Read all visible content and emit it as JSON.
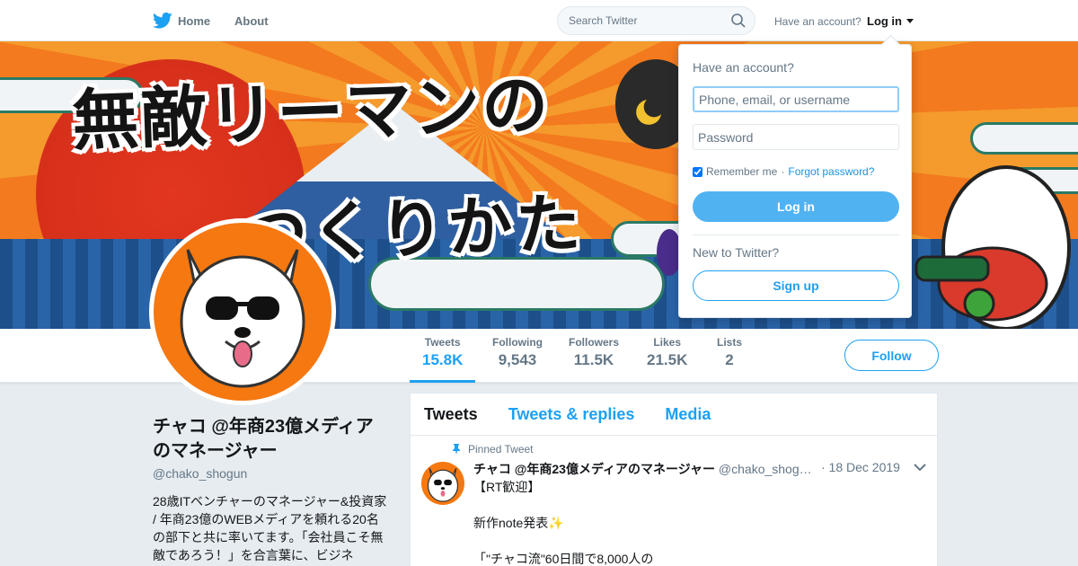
{
  "nav": {
    "home_label": "Home",
    "about_label": "About",
    "search_placeholder": "Search Twitter",
    "have_account": "Have an account?",
    "login_label": "Log in"
  },
  "banner": {
    "title_line1": "無敵リーマンの",
    "title_line2": "つくりかた"
  },
  "stats": [
    {
      "label": "Tweets",
      "value": "15.8K"
    },
    {
      "label": "Following",
      "value": "9,543"
    },
    {
      "label": "Followers",
      "value": "11.5K"
    },
    {
      "label": "Likes",
      "value": "21.5K"
    },
    {
      "label": "Lists",
      "value": "2"
    }
  ],
  "follow_label": "Follow",
  "profile": {
    "name": "チャコ @年商23億メディアのマネージャー",
    "handle": "@chako_shogun",
    "bio": "28歳ITベンチャーのマネージャー&投資家 / 年商23億のWEBメディアを頼れる20名の部下と共に率いてます。「会社員こそ無敵であろう！」を合言葉に、ビジネ"
  },
  "timeline": {
    "tabs": [
      "Tweets",
      "Tweets & replies",
      "Media"
    ],
    "pinned_label": "Pinned Tweet",
    "tweet": {
      "name": "チャコ @年商23億メディアのマネージャー",
      "handle": "@chako_shog…",
      "date": "· 18 Dec 2019",
      "lines": [
        "【RT歓迎】",
        "",
        "新作note発表✨",
        "",
        "「\"チャコ流\"60日間で8,000人の"
      ]
    }
  },
  "login_dropdown": {
    "title": "Have an account?",
    "username_placeholder": "Phone, email, or username",
    "password_placeholder": "Password",
    "remember_label": "Remember me",
    "separator": "·",
    "forgot_label": "Forgot password?",
    "login_button": "Log in",
    "new_label": "New to Twitter?",
    "signup_button": "Sign up"
  },
  "colors": {
    "accent": "#1da1f2",
    "avatar_bg": "#f57811"
  }
}
